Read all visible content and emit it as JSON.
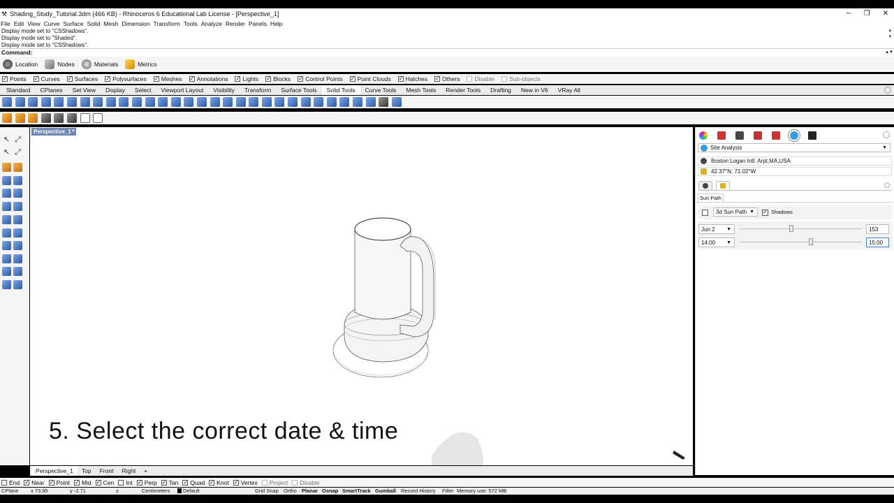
{
  "window": {
    "title": "Shading_Study_Tutorial.3dm (466 KB) - Rhinoceros 6 Educational Lab License - [Perspective_1]",
    "controls": [
      "─",
      "❐",
      "✕"
    ]
  },
  "menu": [
    "File",
    "Edit",
    "View",
    "Curve",
    "Surface",
    "Solid",
    "Mesh",
    "Dimension",
    "Transform",
    "Tools",
    "Analyze",
    "Render",
    "Panels",
    "Help"
  ],
  "command_history": [
    "Display mode set to \"CSShadows\".",
    "Display mode set to \"Shaded\".",
    "Display mode set to \"CSShadows\"."
  ],
  "command_prompt": "Command:",
  "plugin_bar": [
    {
      "label": "Location",
      "icon": "globe-icon"
    },
    {
      "label": "Nodes",
      "icon": "nodes-icon"
    },
    {
      "label": "Materials",
      "icon": "materials-icon"
    },
    {
      "label": "Metrics",
      "icon": "metrics-icon"
    }
  ],
  "filters": [
    {
      "label": "Points",
      "checked": true
    },
    {
      "label": "Curves",
      "checked": true
    },
    {
      "label": "Surfaces",
      "checked": true
    },
    {
      "label": "Polysurfaces",
      "checked": true
    },
    {
      "label": "Meshes",
      "checked": true
    },
    {
      "label": "Annotations",
      "checked": true
    },
    {
      "label": "Lights",
      "checked": true
    },
    {
      "label": "Blocks",
      "checked": true
    },
    {
      "label": "Control Points",
      "checked": true
    },
    {
      "label": "Point Clouds",
      "checked": true
    },
    {
      "label": "Hatches",
      "checked": true
    },
    {
      "label": "Others",
      "checked": true
    },
    {
      "label": "Disable",
      "checked": false
    },
    {
      "label": "Sub-objects",
      "checked": false
    }
  ],
  "toolbar_tabs": [
    "Standard",
    "CPlanes",
    "Set View",
    "Display",
    "Select",
    "Viewport Layout",
    "Visibility",
    "Transform",
    "Surface Tools",
    "Solid Tools",
    "Curve Tools",
    "Mesh Tools",
    "Render Tools",
    "Drafting",
    "New in V6",
    "VRay All"
  ],
  "active_toolbar_tab": "Solid Tools",
  "viewport": {
    "label": "Perspective_1",
    "caption": "5. Select the correct date & time"
  },
  "view_tabs": [
    "Perspective_1",
    "Top",
    "Front",
    "Right",
    "+"
  ],
  "osnaps": [
    {
      "label": "End",
      "checked": false
    },
    {
      "label": "Near",
      "checked": true
    },
    {
      "label": "Point",
      "checked": true
    },
    {
      "label": "Mid",
      "checked": true
    },
    {
      "label": "Cen",
      "checked": true
    },
    {
      "label": "Int",
      "checked": false
    },
    {
      "label": "Perp",
      "checked": true
    },
    {
      "label": "Tan",
      "checked": true
    },
    {
      "label": "Quad",
      "checked": true
    },
    {
      "label": "Knot",
      "checked": true
    },
    {
      "label": "Vertex",
      "checked": true
    },
    {
      "label": "Project",
      "checked": false
    },
    {
      "label": "Disable",
      "checked": false
    }
  ],
  "status": {
    "cplane": "CPlane",
    "x": "x 73.95",
    "y": "y -2.71",
    "z": "z",
    "units": "Centimeters",
    "layer": "Default",
    "grid_snap": "Grid Snap",
    "ortho": "Ortho",
    "planar": "Planar",
    "osnap": "Osnap",
    "smarttrack": "SmartTrack",
    "gumball": "Gumball",
    "record_history": "Record History",
    "filter": "Filter",
    "memory": "Memory use: 572 MB"
  },
  "panel": {
    "selector": "Site Analysis",
    "location": "Boston Logan Intl. Arpt,MA,USA",
    "coordinates": "42.37°N, 71.02°W",
    "section": "Sun Path",
    "sun_path_mode": "3d Sun Path",
    "sun_path_enabled": false,
    "shadows_label": "Shadows",
    "shadows_enabled": true,
    "date": {
      "value": "Jun 2",
      "day_of_year": "153",
      "slider_fraction": 0.42
    },
    "time": {
      "value": "14:00",
      "hour_field": "15:00",
      "slider_fraction": 0.58
    }
  },
  "colors": {
    "viewport_label_bg": "#6f86b3",
    "tool_blue": "#2c5aa8",
    "tool_orange": "#c66b12"
  }
}
